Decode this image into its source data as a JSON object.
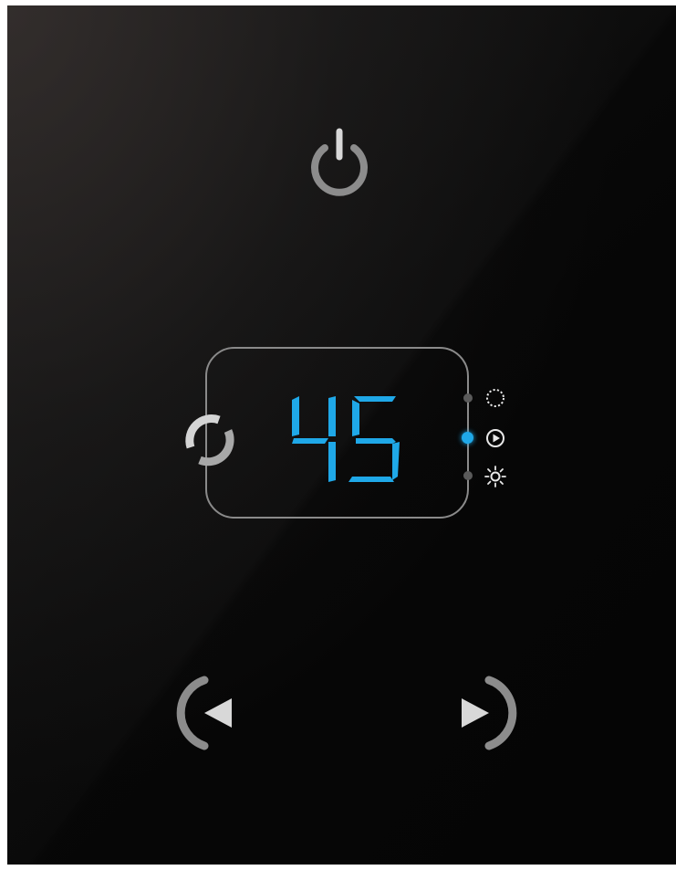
{
  "device": {
    "display_value": "45",
    "accent_color": "#1fa8e8",
    "active_mode": "play",
    "modes": [
      {
        "name": "dotted-circle-icon",
        "active": false
      },
      {
        "name": "play-circle-icon",
        "active": true
      },
      {
        "name": "sun-icon",
        "active": false
      }
    ]
  },
  "icons": {
    "power": "power-icon",
    "loop": "loop-icon",
    "previous": "previous-arrow-icon",
    "next": "next-arrow-icon"
  }
}
